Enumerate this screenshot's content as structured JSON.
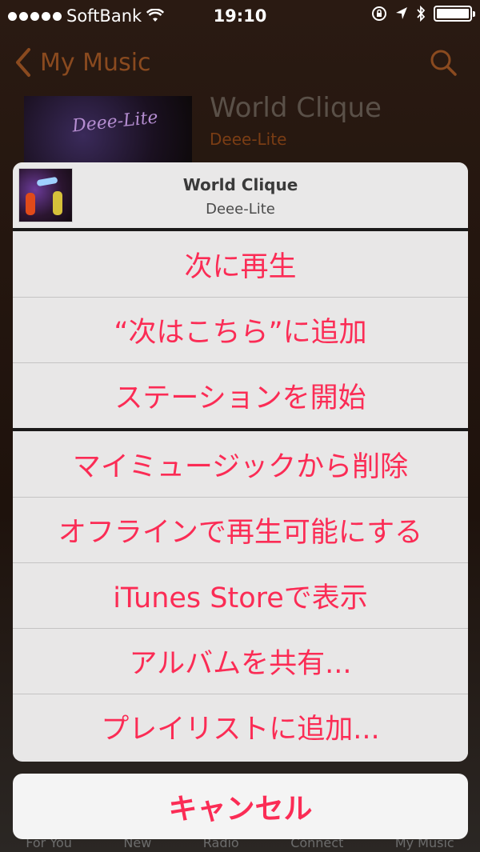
{
  "status": {
    "carrier": "SoftBank",
    "time": "19:10"
  },
  "nav": {
    "back_label": "My Music"
  },
  "background": {
    "album_title": "World Clique",
    "album_artist": "Deee-Lite",
    "tabs": [
      "For You",
      "New",
      "Radio",
      "Connect",
      "My Music"
    ]
  },
  "sheet": {
    "title": "World Clique",
    "subtitle": "Deee-Lite",
    "group1": [
      "次に再生",
      "“次はこちら”に追加",
      "ステーションを開始"
    ],
    "group2": [
      "マイミュージックから削除",
      "オフラインで再生可能にする",
      "iTunes Storeで表示",
      "アルバムを共有...",
      "プレイリストに追加..."
    ],
    "cancel": "キャンセル"
  },
  "colors": {
    "accent": "#fb2c55",
    "nav_orange": "#8a4a1f"
  },
  "icons": [
    "wifi-icon",
    "lock-rotation-icon",
    "location-icon",
    "bluetooth-icon",
    "battery-icon",
    "chevron-left-icon",
    "search-icon"
  ]
}
